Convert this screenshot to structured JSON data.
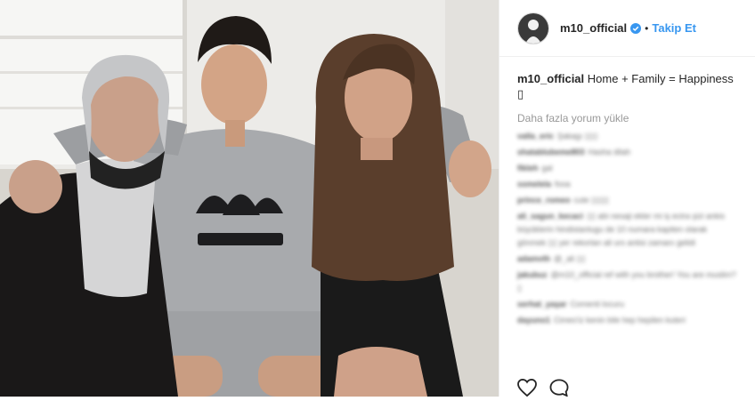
{
  "post": {
    "username": "m10_official",
    "follow_label": "Takip Et",
    "separator": "•",
    "caption_text": "Home + Family = Happiness",
    "caption_emoji": "▯",
    "load_more_label": "Daha fazla yorum yükle"
  },
  "comments": [
    {
      "user": "valla_eric",
      "text": "Şakagı ▯▯▯"
    },
    {
      "user": "shatablubeme803",
      "text": "Hasha dilah"
    },
    {
      "user": "fikleh",
      "text": "gal"
    },
    {
      "user": "ssmelela",
      "text": "fooa"
    },
    {
      "user": "prince_romeo",
      "text": "cute ▯▯▯▯"
    },
    {
      "user": "ali_sagun_kecaci",
      "text": "▯▯ abi nesaji ekler mi iş ectra şizi ankis büyüklerin hindistanlugu de 10 numara kapiten olarak gönmek ▯▯ yer rekorlan ali urs antisi zamanı gelidi"
    },
    {
      "user": "adamvth",
      "text": "@_ali ▯▯"
    },
    {
      "user": "jakubuz",
      "text": "@m10_official ref with you brother! You are muslim? ▯"
    },
    {
      "user": "serhat_yaşar",
      "text": "Comenti locuru"
    },
    {
      "user": "dayuno1",
      "text": "Cimes'iz kenin bile hep hepilen kuteri"
    }
  ],
  "colors": {
    "link": "#3897f0",
    "verified": "#3897f0",
    "text": "#262626",
    "muted": "#999999"
  },
  "icons": [
    "verified-badge-icon",
    "heart-icon",
    "comment-icon"
  ]
}
